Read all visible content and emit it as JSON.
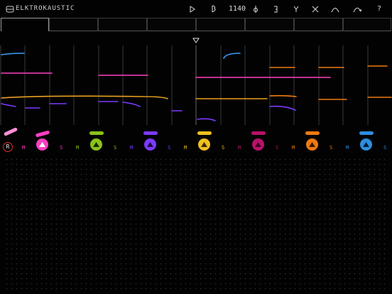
{
  "header": {
    "title": "ELKTROKAUSTIC",
    "toolbar": [
      {
        "id": "play",
        "icon": "play-icon"
      },
      {
        "id": "note",
        "icon": "note-icon"
      },
      {
        "id": "counter",
        "text": "1140"
      },
      {
        "id": "fx-a",
        "icon": "phi-icon"
      },
      {
        "id": "fx-b",
        "icon": "bracket-icon"
      },
      {
        "id": "fx-c",
        "icon": "fork-icon"
      },
      {
        "id": "close",
        "icon": "close-icon"
      },
      {
        "id": "curve",
        "icon": "arc-icon"
      },
      {
        "id": "curve2",
        "icon": "arc-arrow-icon"
      },
      {
        "id": "help",
        "text": "?"
      }
    ]
  },
  "tabs": [
    "",
    "",
    "",
    "",
    "",
    "",
    "",
    ""
  ],
  "active_tab": 0,
  "recorder": {
    "label": "R"
  },
  "channels": [
    {
      "color": "#ff3fc2",
      "m": "M",
      "s": "S"
    },
    {
      "color": "#8bc21a",
      "m": "M",
      "s": "S"
    },
    {
      "color": "#7b3bff",
      "m": "M",
      "s": "S"
    },
    {
      "color": "#f0c020",
      "m": "M",
      "s": "S"
    },
    {
      "color": "#b8126a",
      "m": "M",
      "s": "S"
    },
    {
      "color": "#f07a10",
      "m": "M",
      "s": "S"
    },
    {
      "color": "#2e8ee0",
      "m": "M",
      "s": "S"
    }
  ],
  "colors": {
    "pink": "#ff3fc2",
    "orange": "#f0a020",
    "violet": "#7b3bff",
    "blue": "#3aa0ff",
    "record": "#e03030"
  }
}
